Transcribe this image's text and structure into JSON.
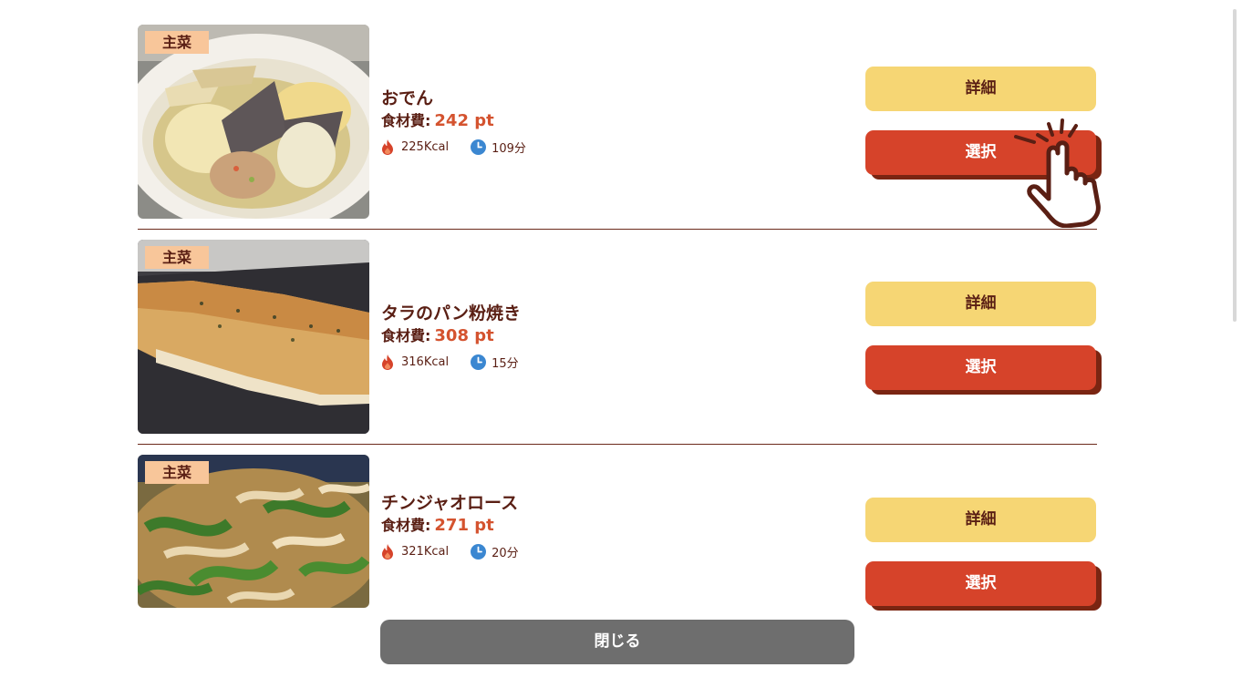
{
  "items": [
    {
      "tag": "主菜",
      "name": "おでん",
      "cost_label": "食材費:",
      "cost_value": "242 pt",
      "calories": "225Kcal",
      "time": "109分",
      "detail_label": "詳細",
      "select_label": "選択"
    },
    {
      "tag": "主菜",
      "name": "タラのパン粉焼き",
      "cost_label": "食材費:",
      "cost_value": "308 pt",
      "calories": "316Kcal",
      "time": "15分",
      "detail_label": "詳細",
      "select_label": "選択"
    },
    {
      "tag": "主菜",
      "name": "チンジャオロース",
      "cost_label": "食材費:",
      "cost_value": "271 pt",
      "calories": "321Kcal",
      "time": "20分",
      "detail_label": "詳細",
      "select_label": "選択"
    }
  ],
  "close_label": "閉じる",
  "icons": {
    "calories": "flame-icon",
    "time": "clock-icon",
    "pointer": "pointing-hand-icon"
  },
  "colors": {
    "tag_bg": "#f8c69a",
    "detail_button": "#f6d674",
    "select_button": "#d6432a",
    "select_shadow": "#7a2512",
    "price": "#d4532f",
    "text": "#5a1f14",
    "close_button": "#6e6e6e",
    "flame": "#d6432a",
    "clock": "#3b87d1"
  }
}
